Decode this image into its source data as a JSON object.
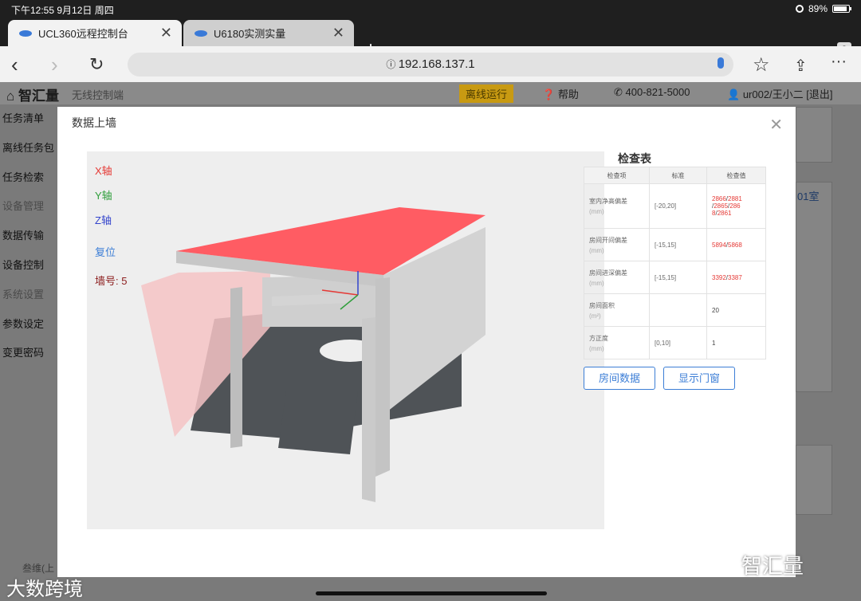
{
  "status": {
    "time": "下午12:55  9月12日 周四",
    "battery": "89%",
    "battery_fill": 0.89
  },
  "tabs": [
    {
      "label": "UCL360远程控制台"
    },
    {
      "label": "U6180实测实量"
    }
  ],
  "tab_count": "2",
  "url": "192.168.137.1",
  "app": {
    "logo": "智汇量",
    "subtitle": "无线控制端",
    "offline": "离线运行",
    "help": "帮助",
    "phone": "400-821-5000",
    "user": "ur002/王小二 [退出]"
  },
  "sidebar": [
    {
      "label": "任务清单",
      "dim": false
    },
    {
      "label": "离线任务包",
      "dim": false
    },
    {
      "label": "任务检索",
      "dim": false
    },
    {
      "label": "设备管理",
      "dim": true
    },
    {
      "label": "数据传输",
      "dim": false
    },
    {
      "label": "设备控制",
      "dim": false
    },
    {
      "label": "系统设置",
      "dim": true
    },
    {
      "label": "参数设定",
      "dim": false
    },
    {
      "label": "变更密码",
      "dim": false
    }
  ],
  "bg_room": "01室",
  "bg_bottom_text": "叁维(上",
  "modal": {
    "title": "数据上墙",
    "viewer": {
      "x_axis": "X轴",
      "y_axis": "Y轴",
      "z_axis": "Z轴",
      "reset": "复位",
      "wall_no": "墙号: 5"
    },
    "panel_title": "检查表",
    "table": {
      "headers": [
        "检查项",
        "标准",
        "检查值"
      ],
      "rows": [
        {
          "item": "室内净高偏差",
          "unit": "(mm)",
          "std": "[-20,20]",
          "value": [
            "2866",
            "/",
            "2881",
            "/",
            "2865",
            "/",
            "286",
            "8",
            "/",
            "2861"
          ]
        },
        {
          "item": "房间开间偏差",
          "unit": "(mm)",
          "std": "[-15,15]",
          "value": [
            "5894",
            "/",
            "5868"
          ]
        },
        {
          "item": "房间进深偏差",
          "unit": "(mm)",
          "std": "[-15,15]",
          "value": [
            "3392",
            "/",
            "3387"
          ]
        },
        {
          "item": "房间面积",
          "unit": "(m²)",
          "std": "",
          "value": [
            "20"
          ]
        },
        {
          "item": "方正度",
          "unit": "(mm)",
          "std": "[0,10]",
          "value": [
            "1"
          ]
        }
      ]
    },
    "btn_room": "房间数据",
    "btn_door": "显示门窗"
  },
  "watermark_right": "智汇量",
  "watermark_left": "大数跨境"
}
